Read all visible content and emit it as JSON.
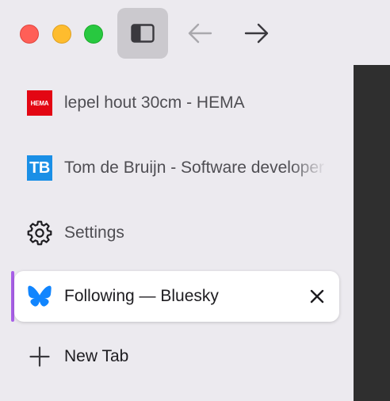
{
  "window": {
    "traffic_lights": {
      "close_color": "#ff5f57",
      "minimize_color": "#febc2e",
      "maximize_color": "#28c840"
    },
    "toolbar": {
      "sidebar_toggle_icon": "sidebar-icon",
      "back_icon": "arrow-left-icon",
      "forward_icon": "arrow-right-icon"
    }
  },
  "tabs": [
    {
      "label": "lepel hout 30cm - HEMA",
      "favicon": "hema-favicon",
      "favicon_text": "HEMA",
      "favicon_color": "#e30613"
    },
    {
      "label": "Tom de Bruijn - Software developer",
      "favicon": "tb-favicon",
      "favicon_text": "TB",
      "favicon_color": "#1a8fe6"
    },
    {
      "label": "Settings",
      "favicon": "gear-icon"
    },
    {
      "label": "Following — Bluesky",
      "favicon": "bluesky-butterfly-icon",
      "active": true,
      "close_icon": "close-icon",
      "accent_color": "#a960e8"
    }
  ],
  "new_tab": {
    "label": "New Tab",
    "icon": "plus-icon"
  }
}
